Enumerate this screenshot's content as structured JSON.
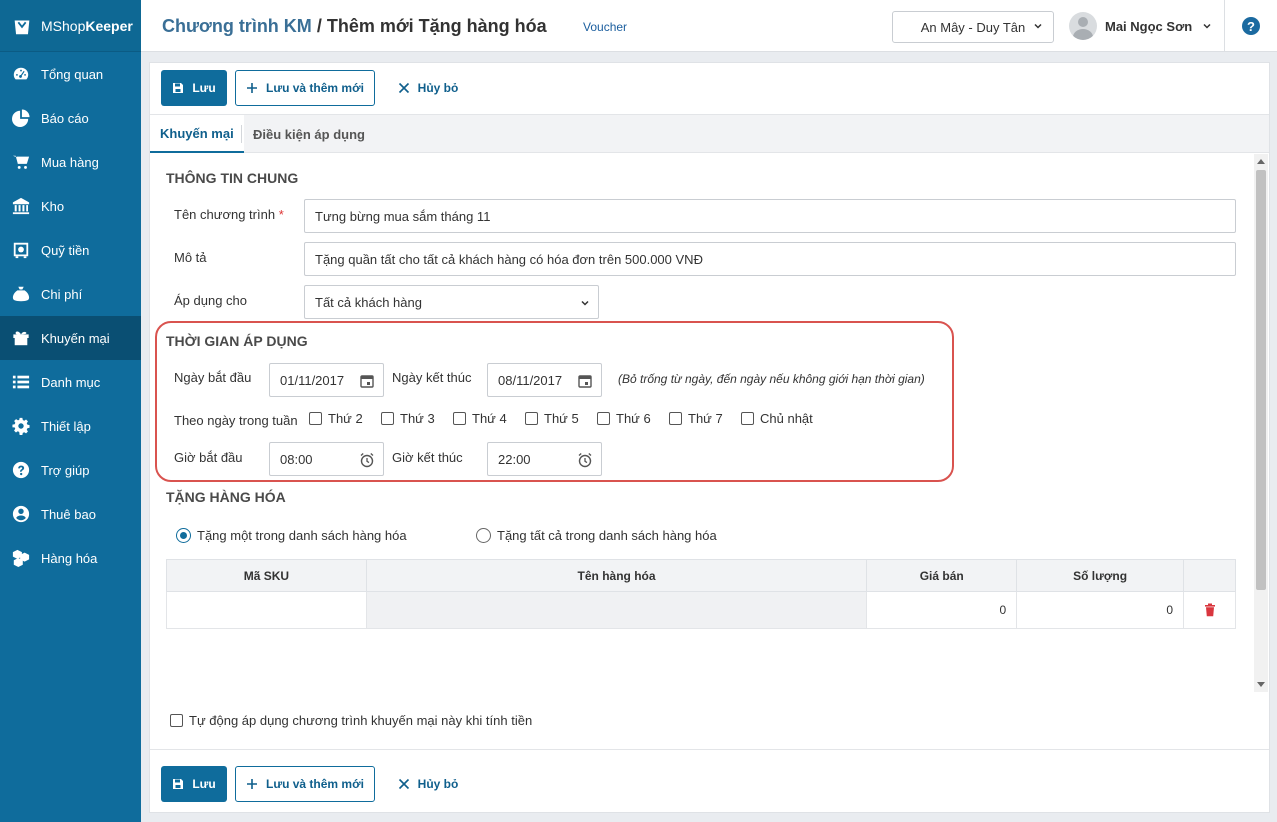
{
  "app": {
    "brand_prefix": "MShop",
    "brand_suffix": "Keeper"
  },
  "sidebar": {
    "items": [
      {
        "label": "Tổng quan",
        "icon": "dashboard-icon"
      },
      {
        "label": "Báo cáo",
        "icon": "pie-chart-icon"
      },
      {
        "label": "Mua hàng",
        "icon": "cart-icon"
      },
      {
        "label": "Kho",
        "icon": "warehouse-icon"
      },
      {
        "label": "Quỹ tiền",
        "icon": "safe-icon"
      },
      {
        "label": "Chi phí",
        "icon": "money-bag-icon"
      },
      {
        "label": "Khuyến mại",
        "icon": "gift-icon",
        "active": true
      },
      {
        "label": "Danh mục",
        "icon": "list-icon"
      },
      {
        "label": "Thiết lập",
        "icon": "gear-icon"
      },
      {
        "label": "Trợ giúp",
        "icon": "help-icon"
      },
      {
        "label": "Thuê bao",
        "icon": "user-icon"
      },
      {
        "label": "Hàng hóa",
        "icon": "boxes-icon"
      }
    ]
  },
  "header": {
    "breadcrumb_parent": "Chương trình KM",
    "breadcrumb_sep": " / ",
    "breadcrumb_current": "Thêm mới Tặng hàng hóa",
    "voucher_link": "Voucher",
    "branch": "An Mây - Duy Tân",
    "user_name": "Mai Ngọc Sơn",
    "help": "?"
  },
  "toolbar": {
    "save": "Lưu",
    "save_new": "Lưu và thêm mới",
    "cancel": "Hủy bỏ"
  },
  "tabs": {
    "promo": "Khuyến mại",
    "conditions": "Điều kiện áp dụng"
  },
  "general": {
    "title": "THÔNG TIN CHUNG",
    "name_label": "Tên chương trình",
    "required_mark": "*",
    "name_value": "Tưng bừng mua sắm tháng 11",
    "desc_label": "Mô tả",
    "desc_value": "Tặng quần tất cho tất cả khách hàng có hóa đơn trên 500.000 VNĐ",
    "apply_label": "Áp dụng cho",
    "apply_value": "Tất cả khách hàng"
  },
  "time": {
    "title": "THỜI GIAN ÁP DỤNG",
    "start_date_label": "Ngày bắt đầu",
    "start_date": "01/11/2017",
    "end_date_label": "Ngày kết thúc",
    "end_date": "08/11/2017",
    "hint": "(Bỏ trống từ ngày, đến ngày nếu không giới hạn thời gian)",
    "weekday_label": "Theo ngày trong tuần",
    "weekdays": [
      "Thứ 2",
      "Thứ 3",
      "Thứ 4",
      "Thứ 5",
      "Thứ 6",
      "Thứ 7",
      "Chủ nhật"
    ],
    "start_time_label": "Giờ bắt đầu",
    "start_time": "08:00",
    "end_time_label": "Giờ kết thúc",
    "end_time": "22:00"
  },
  "gift": {
    "title": "TẶNG HÀNG HÓA",
    "option_one": "Tặng một trong danh sách hàng hóa",
    "option_all": "Tặng tất cả trong danh sách hàng hóa",
    "columns": [
      "Mã SKU",
      "Tên hàng hóa",
      "Giá bán",
      "Số lượng"
    ],
    "rows": [
      {
        "sku": "",
        "name": "",
        "price": "0",
        "qty": "0"
      }
    ]
  },
  "auto_apply": "Tự động áp dụng chương trình khuyến mại này khi tính tiền",
  "colors": {
    "primary": "#0f6c9c",
    "highlight": "#d9534f"
  }
}
